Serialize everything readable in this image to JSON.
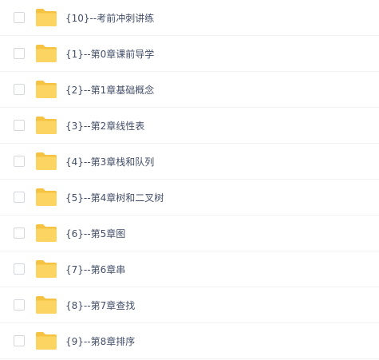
{
  "colors": {
    "folder_back": "#f5c242",
    "folder_front": "#fcd462",
    "text": "#424e67",
    "row_divider": "#f1f2f4",
    "checkbox_border": "#d4d7dd"
  },
  "file_list": {
    "items": [
      {
        "name": "{10}--考前冲刺讲练",
        "icon": "folder-icon"
      },
      {
        "name": "{1}--第0章课前导学",
        "icon": "folder-icon"
      },
      {
        "name": "{2}--第1章基础概念",
        "icon": "folder-icon"
      },
      {
        "name": "{3}--第2章线性表",
        "icon": "folder-icon"
      },
      {
        "name": "{4}--第3章栈和队列",
        "icon": "folder-icon"
      },
      {
        "name": "{5}--第4章树和二叉树",
        "icon": "folder-icon"
      },
      {
        "name": "{6}--第5章图",
        "icon": "folder-icon"
      },
      {
        "name": "{7}--第6章串",
        "icon": "folder-icon"
      },
      {
        "name": "{8}--第7章查找",
        "icon": "folder-icon"
      },
      {
        "name": "{9}--第8章排序",
        "icon": "folder-icon"
      }
    ]
  }
}
